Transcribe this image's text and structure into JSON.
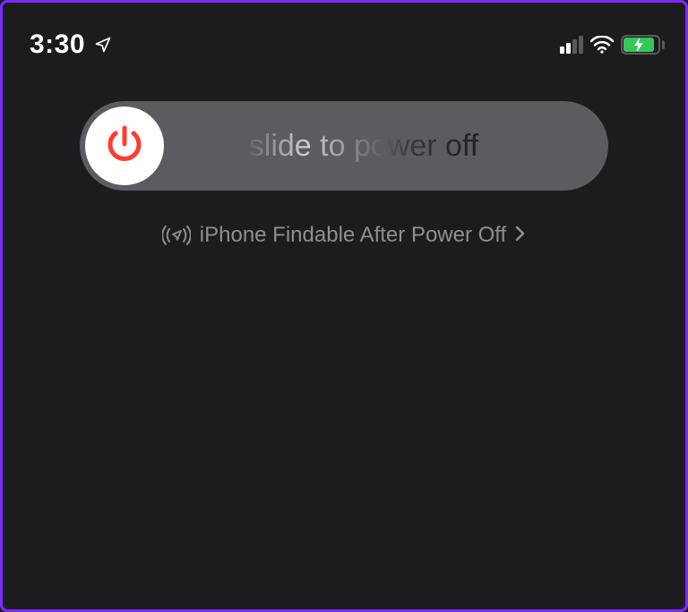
{
  "status_bar": {
    "time": "3:30",
    "location_services_active": true,
    "cellular_bars_active": 2,
    "cellular_bars_total": 4,
    "wifi_strength": 3,
    "battery_charging": true,
    "battery_color": "#34c759"
  },
  "power_slider": {
    "label": "slide to power off"
  },
  "findable_link": {
    "label": "iPhone Findable After Power Off"
  },
  "colors": {
    "background": "#1c1c1e",
    "slider_track": "#5b5c60",
    "power_icon": "#ff3b30",
    "secondary_text": "#8e8e93"
  }
}
